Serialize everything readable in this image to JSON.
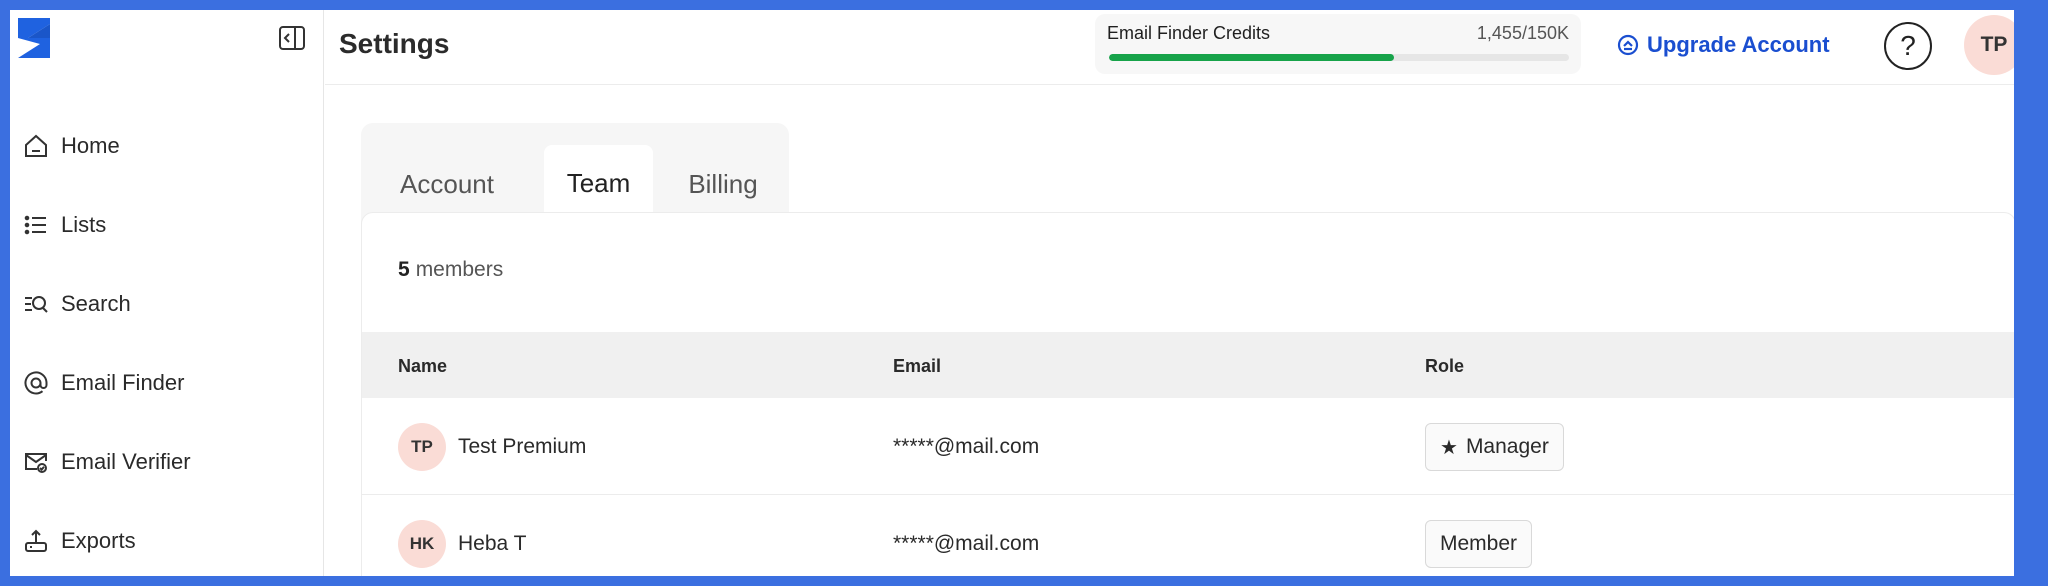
{
  "colors": {
    "frame_border": "#3b6fe0",
    "accent_link": "#1a4ed0",
    "progress_fill": "#17a34a",
    "avatar_bg": "#fadcd6",
    "active_tab_underline": "#2d4fa8"
  },
  "sidebar": {
    "logo_icon": "brand-logo-icon",
    "collapse_icon": "sidebar-collapse-icon",
    "items": [
      {
        "label": "Home",
        "icon": "home-icon"
      },
      {
        "label": "Lists",
        "icon": "list-icon"
      },
      {
        "label": "Search",
        "icon": "search-list-icon"
      },
      {
        "label": "Email Finder",
        "icon": "at-sign-icon"
      },
      {
        "label": "Email Verifier",
        "icon": "mail-check-icon"
      },
      {
        "label": "Exports",
        "icon": "upload-icon"
      }
    ]
  },
  "header": {
    "title": "Settings",
    "credits": {
      "label": "Email Finder Credits",
      "value": "1,455/150K",
      "progress_percent": 62
    },
    "upgrade_label": "Upgrade Account",
    "help_glyph": "?",
    "user_initials": "TP"
  },
  "tabs": [
    {
      "label": "Account",
      "active": false
    },
    {
      "label": "Team",
      "active": true
    },
    {
      "label": "Billing",
      "active": false
    }
  ],
  "team": {
    "member_count": "5",
    "member_count_suffix": "members",
    "columns": [
      "Name",
      "Email",
      "Role"
    ],
    "rows": [
      {
        "initials": "TP",
        "name": "Test Premium",
        "email": "*****@mail.com",
        "role": "Manager",
        "role_icon": "star-icon"
      },
      {
        "initials": "HK",
        "name": "Heba T",
        "email": "*****@mail.com",
        "role": "Member",
        "role_icon": ""
      }
    ]
  }
}
